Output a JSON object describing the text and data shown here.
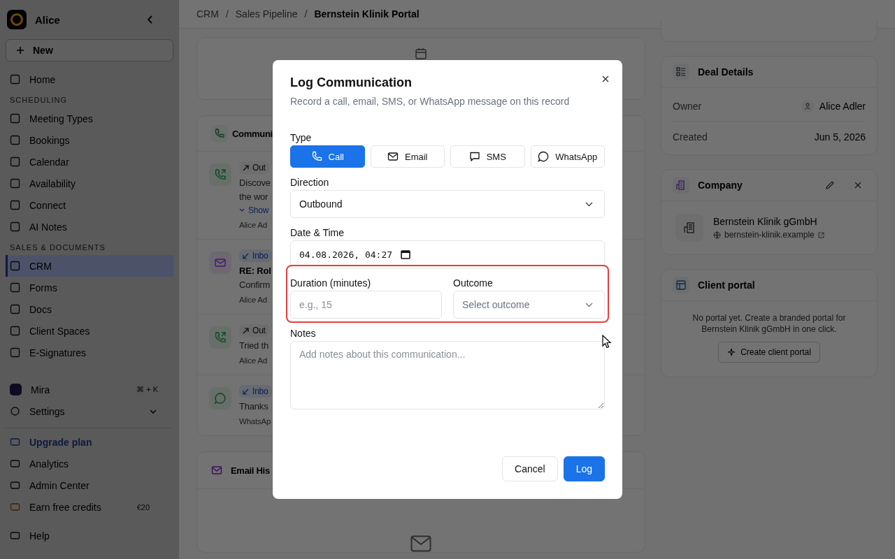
{
  "sidebar": {
    "workspace": "Alice",
    "new_label": "New",
    "items": [
      {
        "kind": "link",
        "label": "Home",
        "selected": false
      },
      {
        "kind": "section",
        "label": "SCHEDULING"
      },
      {
        "kind": "link",
        "label": "Meeting Types",
        "selected": false
      },
      {
        "kind": "link",
        "label": "Bookings",
        "selected": false
      },
      {
        "kind": "link",
        "label": "Calendar",
        "selected": false
      },
      {
        "kind": "link",
        "label": "Availability",
        "selected": false
      },
      {
        "kind": "link",
        "label": "Connect",
        "selected": false
      },
      {
        "kind": "link",
        "label": "AI Notes",
        "selected": false
      },
      {
        "kind": "section",
        "label": "SALES & DOCUMENTS"
      },
      {
        "kind": "link",
        "label": "CRM",
        "selected": true
      },
      {
        "kind": "link",
        "label": "Forms",
        "selected": false
      },
      {
        "kind": "link",
        "label": "Docs",
        "selected": false
      },
      {
        "kind": "link",
        "label": "Client Spaces",
        "selected": false
      },
      {
        "kind": "link",
        "label": "E-Signatures",
        "selected": false
      }
    ],
    "assistant": {
      "label": "Mira",
      "shortcut": "⌘ + K"
    },
    "settings": {
      "label": "Settings",
      "expanded": false
    },
    "footer_items": [
      {
        "kind": "upgrade",
        "label": "Upgrade plan"
      },
      {
        "kind": "link",
        "label": "Analytics"
      },
      {
        "kind": "link",
        "label": "Admin Center"
      },
      {
        "kind": "credits",
        "label": "Earn free credits",
        "badge": "€20"
      },
      {
        "kind": "help",
        "label": "Help"
      }
    ]
  },
  "breadcrumb_separator": "/",
  "breadcrumb": [
    {
      "label": "CRM",
      "current": false
    },
    {
      "label": "Sales Pipeline",
      "current": false
    },
    {
      "label": "Bernstein Klinik Portal",
      "current": true
    }
  ],
  "communications": {
    "title": "Communi",
    "items": [
      {
        "kind": "call",
        "direction": "Out",
        "inbound": false,
        "lines": [
          "Discove",
          "the wor"
        ],
        "link": "Show",
        "meta": "Alice Ad"
      },
      {
        "kind": "email",
        "direction": "Inbo",
        "inbound": true,
        "subject": "RE: Rol",
        "lines": [
          "Confirm"
        ],
        "meta": "Alice Ad"
      },
      {
        "kind": "call",
        "direction": "Out",
        "inbound": false,
        "lines": [
          "Tried th"
        ],
        "meta": "Alice Ad"
      },
      {
        "kind": "whatsapp",
        "direction": "Inbo",
        "inbound": true,
        "lines": [
          "Thanks"
        ],
        "meta": "WhatsAp"
      }
    ]
  },
  "email_history": {
    "title": "Email His"
  },
  "deal_details": {
    "title": "Deal Details",
    "rows": [
      {
        "label": "Owner",
        "value": "Alice Adler",
        "kind": "person"
      },
      {
        "label": "Created",
        "value": "Jun 5, 2026",
        "kind": "text"
      }
    ]
  },
  "company": {
    "title": "Company",
    "name": "Bernstein Klinik gGmbH",
    "domain": "bernstein-klinik.example"
  },
  "client_portal": {
    "title": "Client portal",
    "text": "No portal yet. Create a branded portal for Bernstein Klinik gGmbH in one click.",
    "button": "Create client portal"
  },
  "dialog": {
    "title": "Log Communication",
    "subtitle": "Record a call, email, SMS, or WhatsApp message on this record",
    "type_label": "Type",
    "types": [
      {
        "kind": "call",
        "label": "Call",
        "selected": true
      },
      {
        "kind": "email",
        "label": "Email",
        "selected": false
      },
      {
        "kind": "sms",
        "label": "SMS",
        "selected": false
      },
      {
        "kind": "whatsapp",
        "label": "WhatsApp",
        "selected": false
      }
    ],
    "direction_label": "Direction",
    "direction": "Outbound",
    "datetime_label": "Date & Time",
    "datetime": "04.08.2026, 04:27",
    "duration_label": "Duration (minutes)",
    "duration_placeholder": "e.g., 15",
    "outcome_label": "Outcome",
    "outcome_placeholder": "Select outcome",
    "notes_label": "Notes",
    "notes_placeholder": "Add notes about this communication...",
    "highlighted": true,
    "buttons": [
      {
        "label": "Cancel",
        "kind": "secondary"
      },
      {
        "label": "Log",
        "kind": "primary"
      }
    ]
  }
}
